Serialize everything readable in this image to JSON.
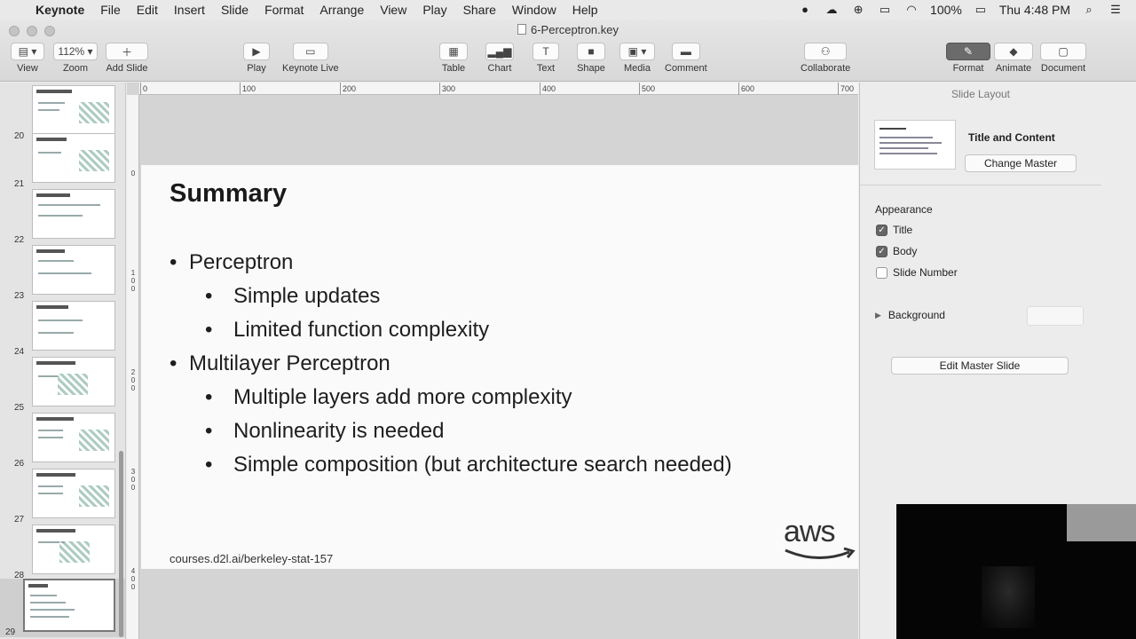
{
  "menubar": {
    "apple": "",
    "app_name": "Keynote",
    "items": [
      "File",
      "Edit",
      "Insert",
      "Slide",
      "Format",
      "Arrange",
      "View",
      "Play",
      "Share",
      "Window",
      "Help"
    ],
    "battery": "100%",
    "clock": "Thu 4:48 PM"
  },
  "toolbar": {
    "doc_title": "6-Perceptron.key",
    "view_label": "View",
    "zoom_value": "112%",
    "zoom_label": "Zoom",
    "add_slide_label": "Add Slide",
    "play_label": "Play",
    "keynote_live_label": "Keynote Live",
    "table_label": "Table",
    "chart_label": "Chart",
    "text_label": "Text",
    "shape_label": "Shape",
    "media_label": "Media",
    "comment_label": "Comment",
    "collaborate_label": "Collaborate",
    "format_label": "Format",
    "animate_label": "Animate",
    "document_label": "Document"
  },
  "navigator": {
    "slide_numbers": [
      "20",
      "21",
      "22",
      "23",
      "24",
      "25",
      "26",
      "27",
      "28",
      "29"
    ],
    "selected": "29"
  },
  "rulers": {
    "h_ticks": [
      "0",
      "100",
      "200",
      "300",
      "400",
      "500",
      "600",
      "700"
    ],
    "v_ticks": [
      "0",
      "1\n0\n0",
      "2\n0\n0",
      "3\n0\n0",
      "4\n0\n0"
    ]
  },
  "slide": {
    "title": "Summary",
    "bullets": [
      {
        "level": 1,
        "text": "Perceptron"
      },
      {
        "level": 2,
        "text": "Simple updates"
      },
      {
        "level": 2,
        "text": "Limited function complexity"
      },
      {
        "level": 1,
        "text": "Multilayer Perceptron"
      },
      {
        "level": 2,
        "text": "Multiple layers add more complexity"
      },
      {
        "level": 2,
        "text": "Nonlinearity is needed"
      },
      {
        "level": 2,
        "text": "Simple composition (but architecture search needed)"
      }
    ],
    "bullet_glyph": "•",
    "footer": "courses.d2l.ai/berkeley-stat-157",
    "logo_text": "aws"
  },
  "inspector": {
    "header": "Slide Layout",
    "layout_name": "Title and Content",
    "change_master": "Change Master",
    "appearance_label": "Appearance",
    "title_check": "Title",
    "body_check": "Body",
    "slide_number_check": "Slide Number",
    "background_label": "Background",
    "edit_master": "Edit Master Slide"
  }
}
